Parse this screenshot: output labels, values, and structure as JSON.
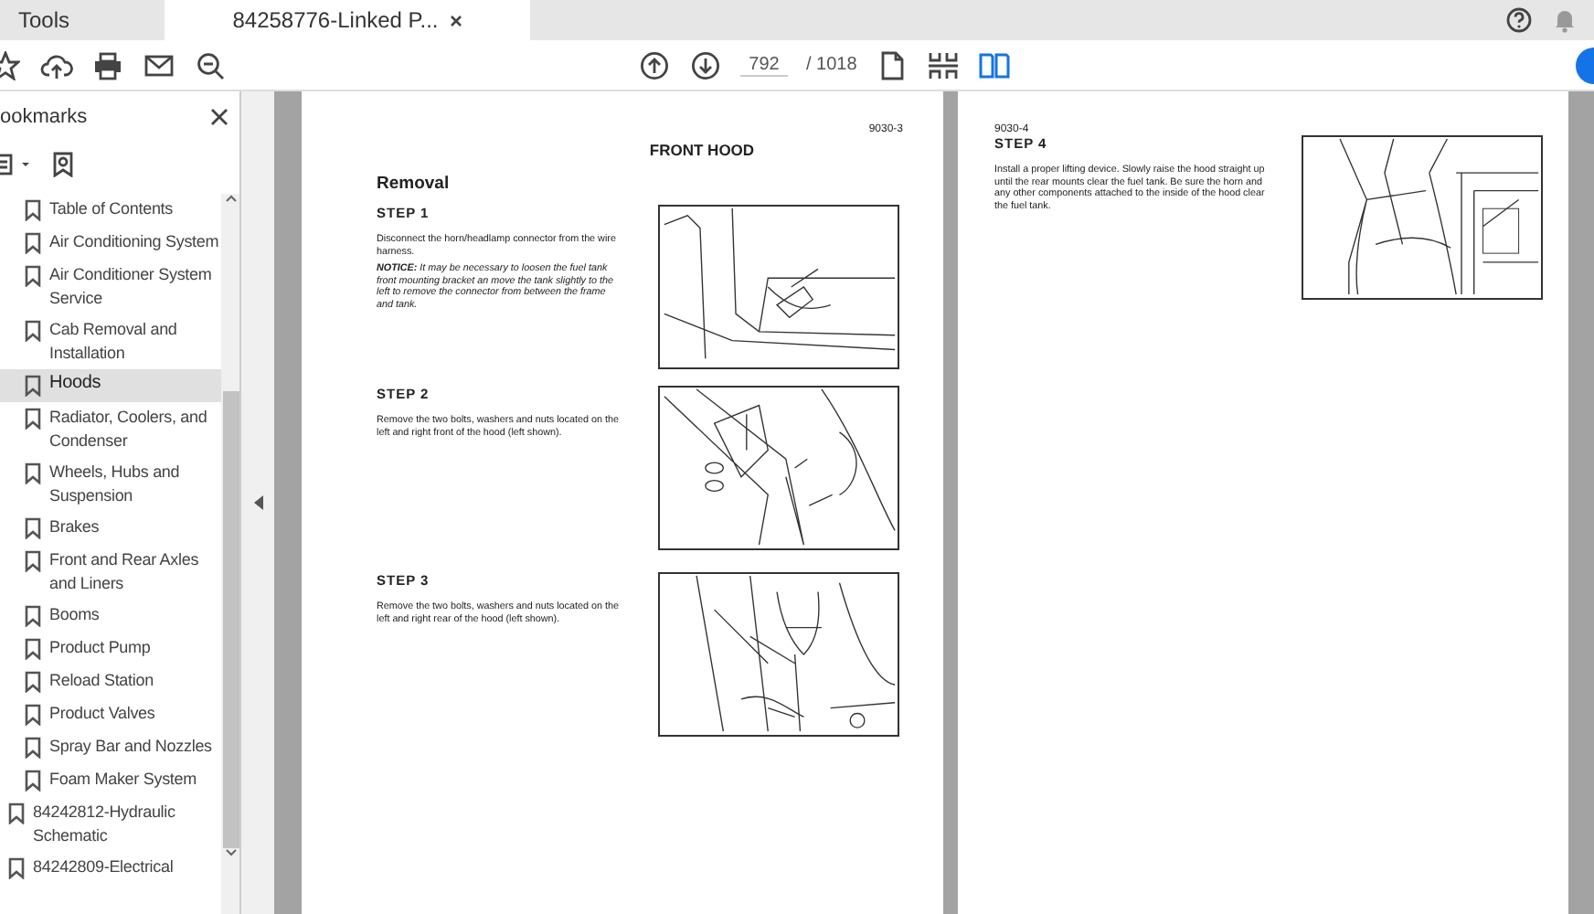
{
  "tabs": [
    {
      "label": "Tools",
      "selected": false
    },
    {
      "label": "84258776-Linked P...",
      "selected": true
    }
  ],
  "toolbar": {
    "page_number": "792",
    "page_total": "/ 1018"
  },
  "bookmarks_panel": {
    "title": "ookmarks",
    "items": [
      {
        "children": [
          {
            "label": "Table of Contents",
            "selected": false
          },
          {
            "label": "Air Conditioning System",
            "selected": false
          },
          {
            "label": "Air Conditioner System Service",
            "selected": false
          },
          {
            "label": "Cab Removal and Installation",
            "selected": false
          },
          {
            "label": "Hoods",
            "selected": true
          },
          {
            "label": "Radiator, Coolers, and Condenser",
            "selected": false
          },
          {
            "label": "Wheels, Hubs and Suspension",
            "selected": false
          },
          {
            "label": "Brakes",
            "selected": false
          },
          {
            "label": "Front and Rear Axles and Liners",
            "selected": false
          },
          {
            "label": "Booms",
            "selected": false
          },
          {
            "label": "Product Pump",
            "selected": false
          },
          {
            "label": "Reload Station",
            "selected": false
          },
          {
            "label": "Product Valves",
            "selected": false
          },
          {
            "label": "Spray Bar and Nozzles",
            "selected": false
          },
          {
            "label": "Foam Maker System",
            "selected": false
          }
        ]
      },
      {
        "label": "84242812-Hydraulic Schematic",
        "selected": false
      },
      {
        "label": "84242809-Electrical",
        "selected": false
      }
    ]
  },
  "pages": [
    {
      "page_number": "9030-3",
      "title": "FRONT HOOD",
      "section": "Removal",
      "steps": [
        {
          "heading": "STEP 1",
          "paragraphs": [
            {
              "text": "Disconnect the horn/headlamp connector from the wire harness.",
              "kind": "plain"
            },
            {
              "text": "**NOTICE:** It may be necessary to loosen the fuel tank front mounting bracket an move the tank slightly to the left to remove the connector from between the frame and tank.",
              "kind": "notice"
            }
          ]
        },
        {
          "heading": "STEP 2",
          "paragraphs": [
            {
              "text": "Remove the two bolts, washers and nuts located on the left and right front of the hood (left shown).",
              "kind": "plain"
            }
          ]
        },
        {
          "heading": "STEP 3",
          "paragraphs": [
            {
              "text": "Remove the two bolts, washers and nuts located on the left and right rear of the hood (left shown).",
              "kind": "plain"
            }
          ]
        }
      ]
    },
    {
      "page_number": "9030-4",
      "steps": [
        {
          "heading": "STEP 4",
          "paragraphs": [
            {
              "text": "Install a proper lifting device. Slowly raise the hood straight up until the rear mounts clear the fuel tank. Be sure the horn and any other components attached to the inside of the hood clear the fuel tank.",
              "kind": "plain"
            }
          ]
        }
      ]
    }
  ]
}
